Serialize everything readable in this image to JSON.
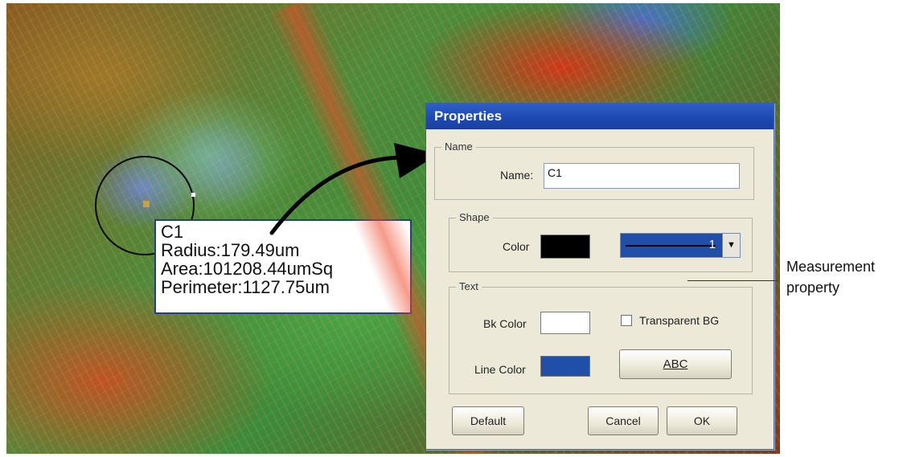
{
  "overlay": {
    "roi_label": "C1",
    "radius": "Radius:179.49um",
    "area": "Area:101208.44umSq",
    "perimeter": "Perimeter:1127.75um"
  },
  "dialog": {
    "title": "Properties",
    "name_group": {
      "legend": "Name",
      "field_label": "Name:",
      "field_value": "C1"
    },
    "shape_group": {
      "legend": "Shape",
      "color_label": "Color",
      "color_value": "#000000",
      "line_width": "1"
    },
    "text_group": {
      "legend": "Text",
      "bk_color_label": "Bk Color",
      "bk_color_value": "#ffffff",
      "transparent_label": "Transparent BG",
      "transparent_checked": false,
      "line_color_label": "Line Color",
      "line_color_value": "#1f4fa8",
      "font_button_label": "ABC"
    },
    "buttons": {
      "default_label": "Default",
      "cancel_label": "Cancel",
      "ok_label": "OK"
    }
  },
  "annotation": {
    "line1": "Measurement",
    "line2": "property"
  },
  "colors": {
    "titlebar": "#1d49b3",
    "dialog_bg": "#ece9d8",
    "overlay_border": "#243d8a"
  }
}
